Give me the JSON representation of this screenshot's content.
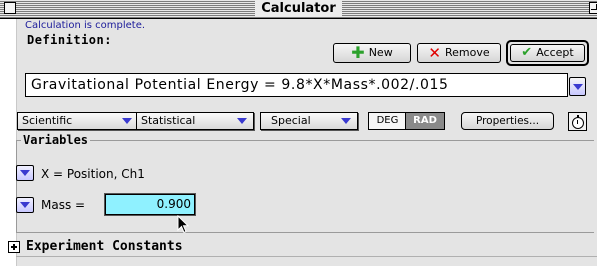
{
  "window": {
    "title": "Calculator"
  },
  "status": {
    "message": "Calculation is complete."
  },
  "definition": {
    "label": "Definition:",
    "formula": "Gravitational Potential Energy = 9.8*X*Mass*.002/.015"
  },
  "buttons": {
    "new_label": "New",
    "remove_label": "Remove",
    "accept_label": "Accept",
    "properties_label": "Properties..."
  },
  "function_menus": {
    "scientific": "Scientific",
    "statistical": "Statistical",
    "special": "Special"
  },
  "angle_mode": {
    "deg": "DEG",
    "rad": "RAD",
    "selected": "RAD"
  },
  "variables": {
    "title": "Variables",
    "items": [
      {
        "label": "X = Position, Ch1"
      },
      {
        "label": "Mass =",
        "value": "0.900"
      }
    ]
  },
  "experiment_constants": {
    "label": "Experiment Constants"
  },
  "colors": {
    "panel_bg": "#e4e4e4",
    "field_highlight": "#8ff1ff",
    "plus_green": "#2ca12c",
    "remove_red": "#e00000",
    "popup_arrow_blue": "#3a3ad0",
    "status_text_blue": "#1b1b9a"
  },
  "icons": {
    "new": "plus-icon",
    "remove": "x-icon",
    "accept": "checkmark-icon",
    "timer": "stopwatch-icon",
    "expand": "plus-box-icon"
  }
}
